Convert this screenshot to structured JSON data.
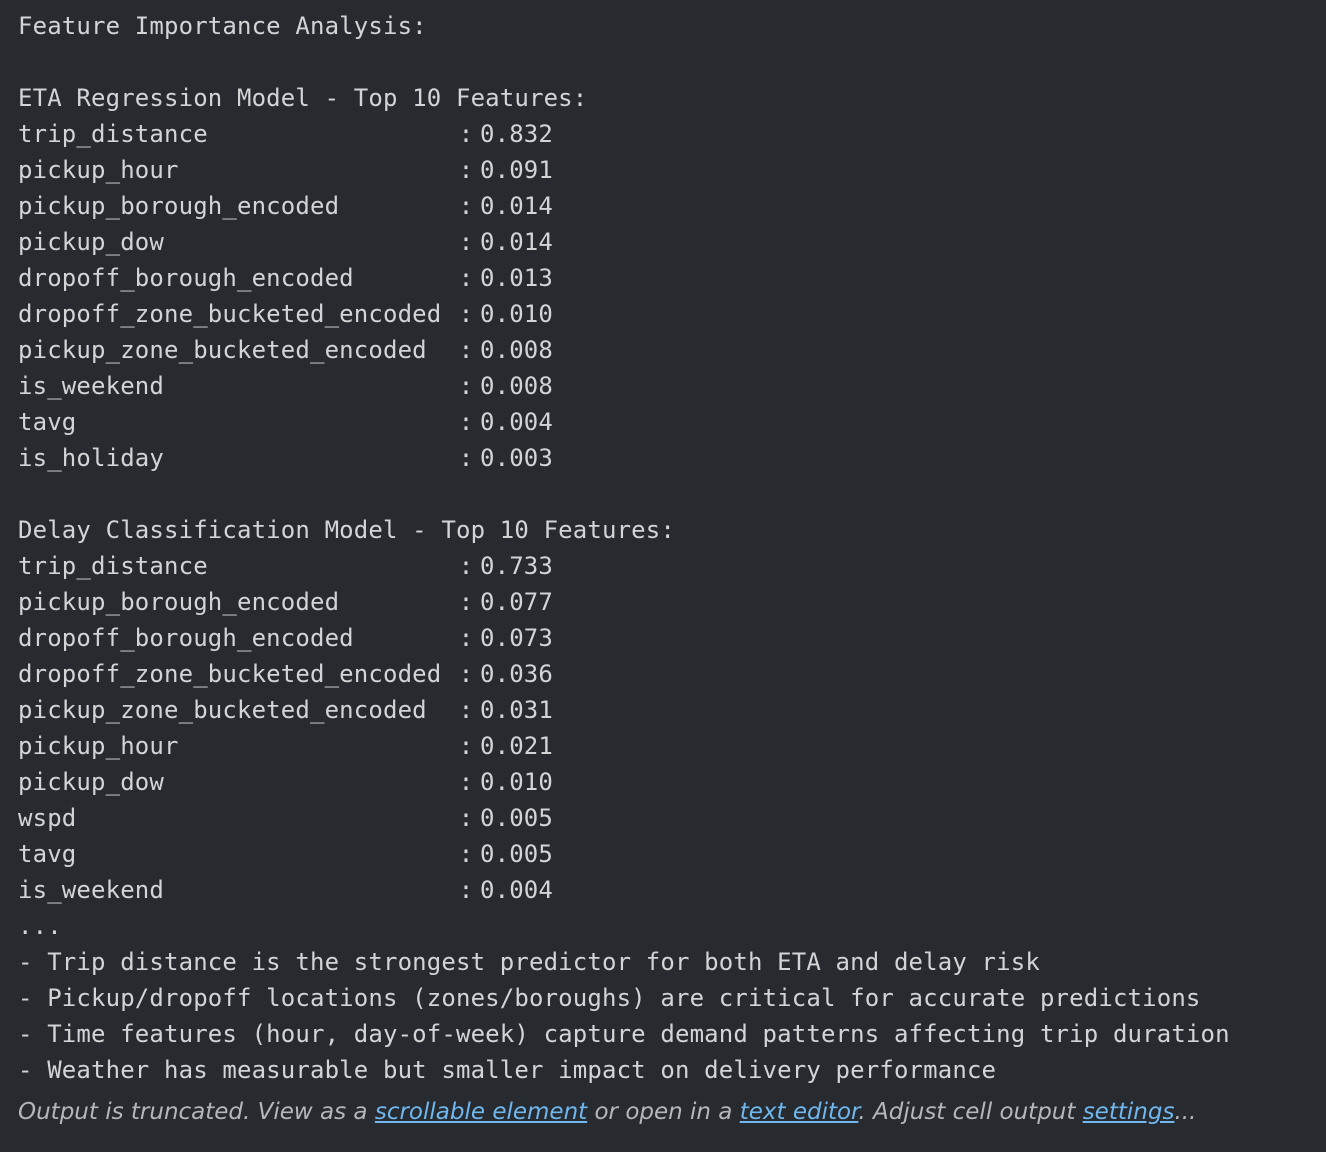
{
  "header": "Feature Importance Analysis:",
  "eta": {
    "title": "ETA Regression Model - Top 10 Features:",
    "features": [
      {
        "name": "trip_distance",
        "sep": ":",
        "value": "0.832"
      },
      {
        "name": "pickup_hour",
        "sep": ":",
        "value": "0.091"
      },
      {
        "name": "pickup_borough_encoded",
        "sep": ":",
        "value": "0.014"
      },
      {
        "name": "pickup_dow",
        "sep": ":",
        "value": "0.014"
      },
      {
        "name": "dropoff_borough_encoded",
        "sep": ":",
        "value": "0.013"
      },
      {
        "name": "dropoff_zone_bucketed_encoded",
        "sep": ":",
        "value": "0.010"
      },
      {
        "name": "pickup_zone_bucketed_encoded",
        "sep": ":",
        "value": "0.008"
      },
      {
        "name": "is_weekend",
        "sep": ":",
        "value": "0.008"
      },
      {
        "name": "tavg",
        "sep": ":",
        "value": "0.004"
      },
      {
        "name": "is_holiday",
        "sep": ":",
        "value": "0.003"
      }
    ]
  },
  "delay": {
    "title": "Delay Classification Model - Top 10 Features:",
    "features": [
      {
        "name": "trip_distance",
        "sep": ":",
        "value": "0.733"
      },
      {
        "name": "pickup_borough_encoded",
        "sep": ":",
        "value": "0.077"
      },
      {
        "name": "dropoff_borough_encoded",
        "sep": ":",
        "value": "0.073"
      },
      {
        "name": "dropoff_zone_bucketed_encoded",
        "sep": ":",
        "value": "0.036"
      },
      {
        "name": "pickup_zone_bucketed_encoded",
        "sep": ":",
        "value": "0.031"
      },
      {
        "name": "pickup_hour",
        "sep": ":",
        "value": "0.021"
      },
      {
        "name": "pickup_dow",
        "sep": ":",
        "value": "0.010"
      },
      {
        "name": "wspd",
        "sep": ":",
        "value": "0.005"
      },
      {
        "name": "tavg",
        "sep": ":",
        "value": "0.005"
      },
      {
        "name": "is_weekend",
        "sep": ":",
        "value": "0.004"
      }
    ]
  },
  "ellipsis": "...",
  "insights": [
    "- Trip distance is the strongest predictor for both ETA and delay risk",
    "- Pickup/dropoff locations (zones/boroughs) are critical for accurate predictions",
    "- Time features (hour, day-of-week) capture demand patterns affecting trip duration",
    "- Weather has measurable but smaller impact on delivery performance"
  ],
  "truncation": {
    "prefix": "Output is truncated. View as a ",
    "scrollable_link": "scrollable element",
    "middle": " or open in a ",
    "editor_link": "text editor",
    "after_editor": ". Adjust cell output ",
    "settings_link": "settings",
    "suffix": "..."
  },
  "colors": {
    "background": "#272b30",
    "text": "#d2d4d6",
    "link": "#6fb7ee",
    "muted": "#b4b7ba"
  }
}
